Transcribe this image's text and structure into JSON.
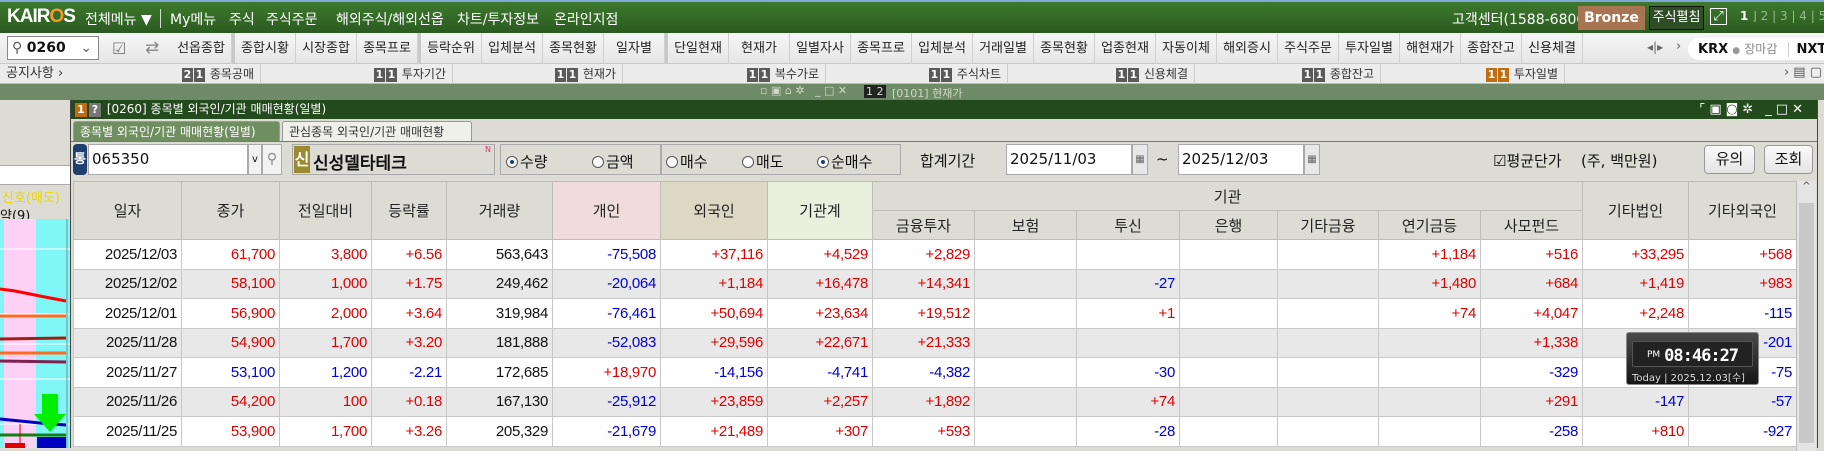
{
  "menubar": {
    "logo": "KAIROS",
    "items": [
      "전체메뉴 ▼",
      "My메뉴",
      "주식",
      "주식주문",
      "해외주식/해외선옵",
      "차트/투자정보",
      "온라인지점"
    ],
    "customer_center": "고객센터(1588-6800)",
    "grade": "Bronze",
    "expand_label": "주식펼침",
    "screens": [
      "1",
      "2",
      "3",
      "4",
      "5"
    ]
  },
  "toolbar": {
    "code": "0260",
    "buttons": [
      "선옵종합",
      "종합시황",
      "시장종합",
      "종목프로",
      "등락순위",
      "입체분석",
      "종목현황",
      "일자별",
      "단일현재",
      "현재가",
      "일별자사",
      "종목프로",
      "입체분석",
      "거래일별",
      "종목현황",
      "업종현재",
      "자동이체",
      "해외증시",
      "주식주문",
      "투자일별",
      "해현재가",
      "종합잔고",
      "신용체결"
    ],
    "market_status": {
      "krx": "KRX",
      "krx_status": "장마감",
      "nxt": "NXT"
    }
  },
  "quick_tabs": {
    "notice": "공지사항 ›",
    "items": [
      {
        "badge": [
          "2",
          "1"
        ],
        "label": "종목공매"
      },
      {
        "badge": [
          "1",
          "1"
        ],
        "label": "투자기간"
      },
      {
        "badge": [
          "1",
          "1"
        ],
        "label": "현재가"
      },
      {
        "badge": [
          "1",
          "1"
        ],
        "label": "복수가로"
      },
      {
        "badge": [
          "1",
          "1"
        ],
        "label": "주식차트"
      },
      {
        "badge": [
          "1",
          "1"
        ],
        "label": "신용체결"
      },
      {
        "badge": [
          "1",
          "1"
        ],
        "label": "종합잔고"
      },
      {
        "badge": [
          "1",
          "1"
        ],
        "label": "투자일별",
        "active": true
      }
    ]
  },
  "behind_window": {
    "badge": "1 2",
    "title": "[0101] 현재가"
  },
  "left_chart": {
    "signal": "신호(매도)",
    "label": "약(9)"
  },
  "window": {
    "badge1": "1",
    "badge2": "?",
    "title": "[0260] 종목별 외국인/기관 매매현황(일별)",
    "subtabs": [
      "종목별 외국인/기관 매매현황(일별)",
      "관심종목 외국인/기관 매매현황"
    ],
    "stock_type": "통",
    "stock_code": "065350",
    "stock_market_badge": "신",
    "stock_name": "신성델타테크",
    "new_mark": "N",
    "unit_options": [
      {
        "label": "수량",
        "selected": true
      },
      {
        "label": "금액",
        "selected": false
      }
    ],
    "trade_options": [
      {
        "label": "매수",
        "selected": false
      },
      {
        "label": "매도",
        "selected": false
      },
      {
        "label": "순매수",
        "selected": true
      }
    ],
    "period_label": "합계기간",
    "date_from": "2025/11/03",
    "date_sep": "~",
    "date_to": "2025/12/03",
    "avg_price_label": "평균단가",
    "avg_price_checked": true,
    "unit_label": "(주, 백만원)",
    "notice_button": "유의",
    "query_button": "조회"
  },
  "table": {
    "headers": {
      "date": "일자",
      "close": "종가",
      "change": "전일대비",
      "rate": "등락률",
      "volume": "거래량",
      "individual": "개인",
      "foreign": "외국인",
      "inst_total": "기관계",
      "institution": "기관",
      "fin_invest": "금융투자",
      "insurance": "보험",
      "trust": "투신",
      "bank": "은행",
      "other_fin": "기타금융",
      "pension": "연기금등",
      "private_fund": "사모펀드",
      "other_corp": "기타법인",
      "other_foreign": "기타외국인"
    },
    "rows": [
      {
        "dir": "up",
        "cells": [
          "2025/12/03",
          "61,700",
          "3,800",
          "+6.56",
          "563,643",
          "-75,508",
          "+37,116",
          "+4,529",
          "+2,829",
          "",
          "",
          "",
          "",
          "+1,184",
          "+516",
          "+33,295",
          "+568"
        ]
      },
      {
        "dir": "up",
        "cells": [
          "2025/12/02",
          "58,100",
          "1,000",
          "+1.75",
          "249,462",
          "-20,064",
          "+1,184",
          "+16,478",
          "+14,341",
          "",
          "-27",
          "",
          "",
          "+1,480",
          "+684",
          "+1,419",
          "+983"
        ]
      },
      {
        "dir": "up",
        "cells": [
          "2025/12/01",
          "56,900",
          "2,000",
          "+3.64",
          "319,984",
          "-76,461",
          "+50,694",
          "+23,634",
          "+19,512",
          "",
          "+1",
          "",
          "",
          "+74",
          "+4,047",
          "+2,248",
          "-115"
        ]
      },
      {
        "dir": "up",
        "cells": [
          "2025/11/28",
          "54,900",
          "1,700",
          "+3.20",
          "181,888",
          "-52,083",
          "+29,596",
          "+22,671",
          "+21,333",
          "",
          "",
          "",
          "",
          "",
          "+1,338",
          "",
          "-201"
        ]
      },
      {
        "dir": "down",
        "cells": [
          "2025/11/27",
          "53,100",
          "1,200",
          "-2.21",
          "172,685",
          "+18,970",
          "-14,156",
          "-4,741",
          "-4,382",
          "",
          "-30",
          "",
          "",
          "",
          "-329",
          "",
          "-75"
        ]
      },
      {
        "dir": "up",
        "cells": [
          "2025/11/26",
          "54,200",
          "100",
          "+0.18",
          "167,130",
          "-25,912",
          "+23,859",
          "+2,257",
          "+1,892",
          "",
          "+74",
          "",
          "",
          "",
          "+291",
          "-147",
          "-57"
        ]
      },
      {
        "dir": "up",
        "cells": [
          "2025/11/25",
          "53,900",
          "1,700",
          "+3.26",
          "205,329",
          "-21,679",
          "+21,489",
          "+307",
          "+593",
          "",
          "-28",
          "",
          "",
          "",
          "-258",
          "+810",
          "-927"
        ]
      }
    ]
  },
  "clock": {
    "ampm": "PM",
    "time": "08:46:27",
    "today_label": "Today",
    "date": "2025.12.03[수]"
  },
  "colors": {
    "up": "#e00000",
    "down": "#0000d0",
    "menubar": "#2b5a20",
    "window_title": "#234a1c",
    "active_badge": "#c06c10"
  }
}
